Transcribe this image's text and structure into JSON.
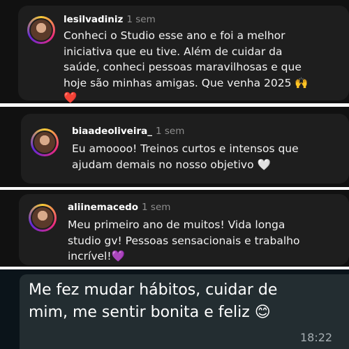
{
  "comments": [
    {
      "username": "lesilvadiniz",
      "time": "1 sem",
      "lines": [
        "Conheci o Studio esse ano e foi a melhor",
        "iniciativa que eu tive. Além de cuidar da",
        "saúde, conheci pessoas maravilhosas e que",
        "hoje são minhas amigas. Que venha 2025 🙌",
        "❤️"
      ]
    },
    {
      "username": "biaadeoliveira_",
      "time": "1 sem",
      "lines": [
        "Eu amoooo! Treinos curtos e intensos que",
        "ajudam demais no nosso objetivo 🤍"
      ]
    },
    {
      "username": "aliinemacedo",
      "time": "1 sem",
      "lines": [
        "Meu primeiro ano de muitos! Vida longa",
        "studio gv! Pessoas sensacionais e trabalho",
        "incrível!💜"
      ]
    }
  ],
  "chat_message": {
    "lines": [
      "Me fez mudar hábitos, cuidar de",
      "mim, me sentir bonita e feliz 😊"
    ],
    "time": "18:22"
  }
}
